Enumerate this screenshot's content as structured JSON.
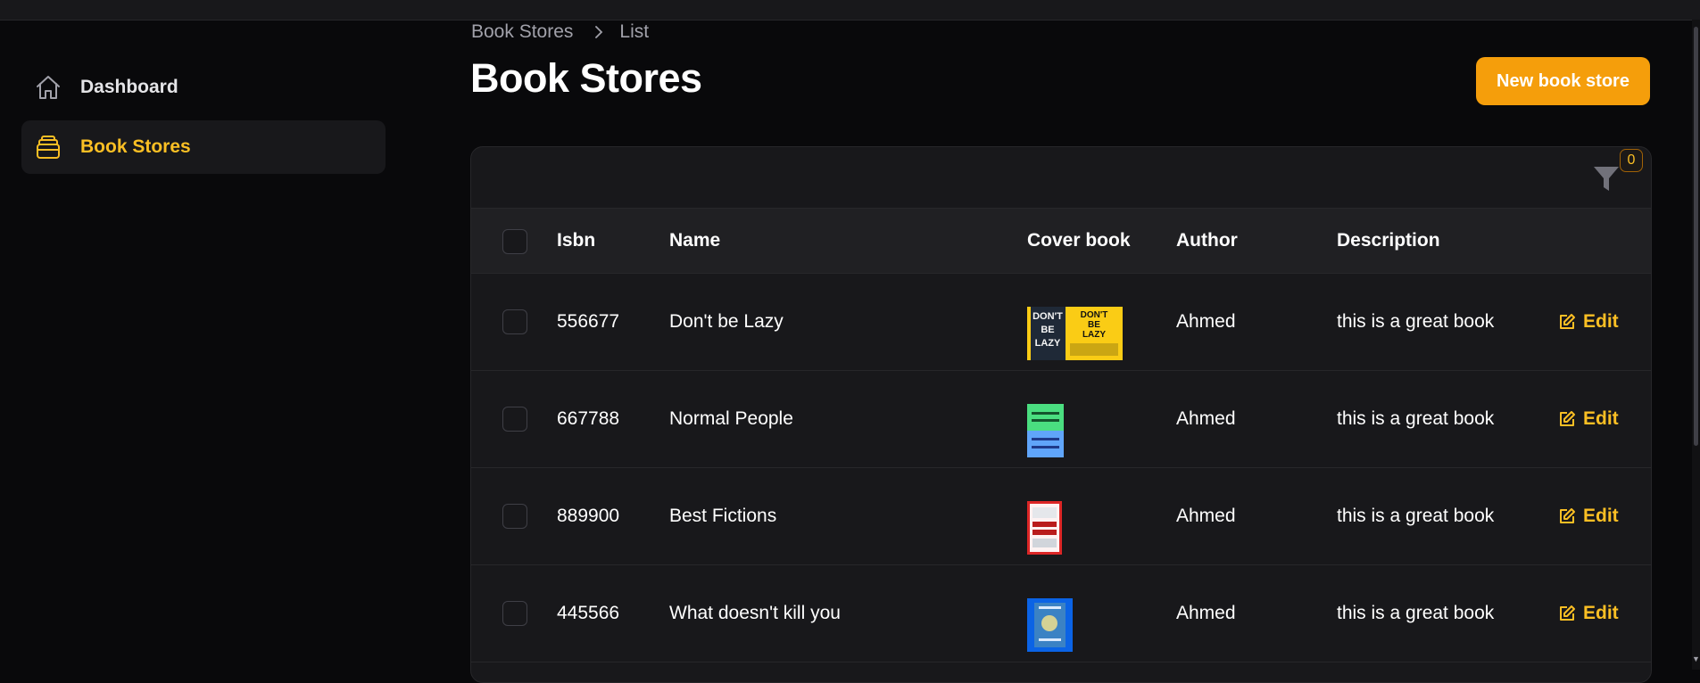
{
  "sidebar": {
    "items": [
      {
        "label": "Dashboard",
        "icon": "home-icon",
        "active": false
      },
      {
        "label": "Book Stores",
        "icon": "stack-icon",
        "active": true
      }
    ]
  },
  "breadcrumb": {
    "items": [
      "Book Stores",
      "List"
    ]
  },
  "header": {
    "title": "Book Stores",
    "new_button": "New book store"
  },
  "filter": {
    "count": "0"
  },
  "table": {
    "columns": [
      "Isbn",
      "Name",
      "Cover book",
      "Author",
      "Description"
    ],
    "edit_label": "Edit",
    "rows": [
      {
        "isbn": "556677",
        "name": "Don't be Lazy",
        "author": "Ahmed",
        "description": "this is a great book"
      },
      {
        "isbn": "667788",
        "name": "Normal People",
        "author": "Ahmed",
        "description": "this is a great book"
      },
      {
        "isbn": "889900",
        "name": "Best Fictions",
        "author": "Ahmed",
        "description": "this is a great book"
      },
      {
        "isbn": "445566",
        "name": "What doesn't kill you",
        "author": "Ahmed",
        "description": "this is a great book"
      }
    ]
  },
  "colors": {
    "accent": "#f59e0b",
    "accent_text": "#fbbf24",
    "background": "#09090b",
    "surface": "#18181b"
  }
}
